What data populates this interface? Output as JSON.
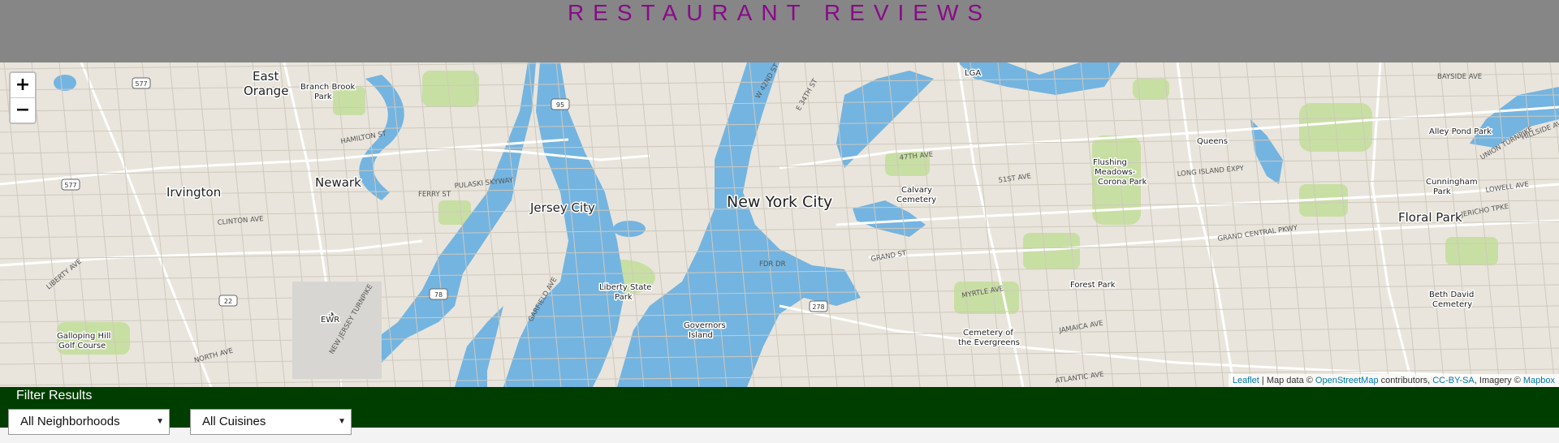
{
  "header": {
    "title": "RESTAURANT REVIEWS"
  },
  "map": {
    "zoom_in": "+",
    "zoom_out": "−",
    "places": [
      {
        "label": "New York City",
        "size": "large"
      },
      {
        "label": "Jersey City",
        "size": "medium"
      },
      {
        "label": "Newark",
        "size": "medium"
      },
      {
        "label": "Floral Park",
        "size": "medium"
      },
      {
        "label": "East",
        "size": "medium"
      },
      {
        "label": "Orange",
        "size": "medium"
      },
      {
        "label": "Irvington",
        "size": "medium"
      },
      {
        "label": "Queens",
        "size": "small"
      },
      {
        "label": "Forest Park",
        "size": "small"
      },
      {
        "label": "Flushing",
        "size": "small"
      },
      {
        "label": "Meadows-",
        "size": "small"
      },
      {
        "label": "Corona Park",
        "size": "small"
      },
      {
        "label": "Calvary",
        "size": "small"
      },
      {
        "label": "Cemetery",
        "size": "small"
      },
      {
        "label": "Liberty State",
        "size": "small"
      },
      {
        "label": "Park",
        "size": "small"
      },
      {
        "label": "Governors",
        "size": "small"
      },
      {
        "label": "Island",
        "size": "small"
      },
      {
        "label": "Alley Pond Park",
        "size": "small"
      },
      {
        "label": "Cunningham",
        "size": "small"
      },
      {
        "label": "Park",
        "size": "small"
      },
      {
        "label": "Cemetery of",
        "size": "small"
      },
      {
        "label": "the Evergreens",
        "size": "small"
      },
      {
        "label": "Galloping Hill",
        "size": "small"
      },
      {
        "label": "Golf Course",
        "size": "small"
      },
      {
        "label": "Branch Brook",
        "size": "small"
      },
      {
        "label": "Park",
        "size": "small"
      },
      {
        "label": "Beth David",
        "size": "small"
      },
      {
        "label": "Cemetery",
        "size": "small"
      },
      {
        "label": "LGA",
        "size": "small"
      },
      {
        "label": "EWR",
        "size": "small"
      }
    ],
    "streets": [
      "PULASKI SKYWAY",
      "GRAND CENTRAL PKWY",
      "LONG ISLAND EXPY",
      "MYRTLE AVE",
      "JAMAICA AVE",
      "ATLANTIC AVE",
      "GRAND ST",
      "FDR DR",
      "47TH AVE",
      "51ST AVE",
      "LOWELL AVE",
      "HILLSIDE AVE",
      "UNION TURNPIKE",
      "BAYSIDE AVE",
      "NORTH AVE",
      "CLINTON AVE",
      "LIBERTY AVE",
      "HAMILTON ST",
      "FERRY ST",
      "GARFIELD AVE",
      "W 42ND ST",
      "E 34TH ST",
      "JERICHO TPKE",
      "NEW JERSEY TURNPIKE"
    ],
    "highway_shields": [
      "577",
      "577",
      "95",
      "78",
      "22",
      "278"
    ],
    "attribution": {
      "leaflet": "Leaflet",
      "text1": " | Map data © ",
      "osm": "OpenStreetMap",
      "text2": " contributors, ",
      "license": "CC-BY-SA",
      "text3": ", Imagery © ",
      "mapbox": "Mapbox"
    }
  },
  "filter": {
    "title": "Filter Results",
    "neighborhoods": "All Neighborhoods",
    "cuisines": "All Cuisines"
  },
  "colors": {
    "header_bg": "#868686",
    "title_color": "#8a0a8a",
    "filter_bg": "#003e00",
    "water": "#74b4e0",
    "land": "#e9e5dc",
    "park": "#c8dfa3"
  }
}
